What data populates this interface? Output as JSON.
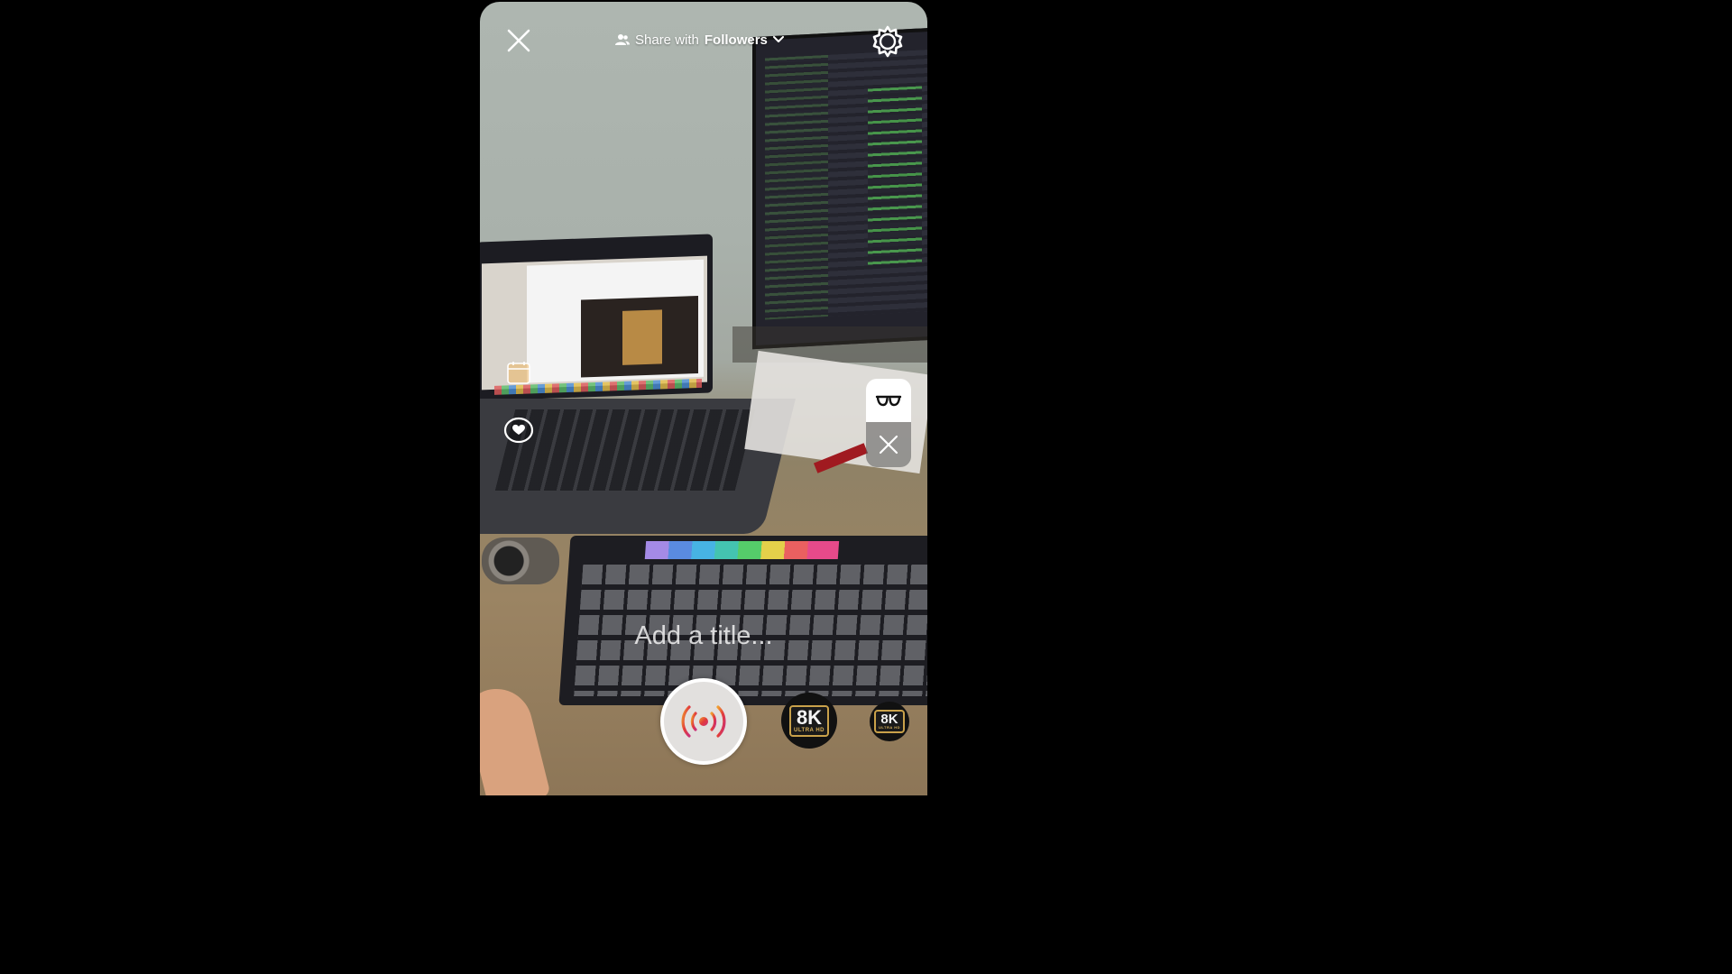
{
  "header": {
    "share_prefix": "Share with",
    "share_audience": "Followers",
    "close_icon": "close-icon",
    "settings_icon": "gear-icon",
    "audience_icon": "people-icon",
    "dropdown_icon": "chevron-down-icon"
  },
  "side_tools": {
    "effect_icon": "glasses-icon",
    "effect_close_icon": "close-icon",
    "heart_icon": "heart-icon",
    "sticker_icon": "calendar-icon"
  },
  "bottom": {
    "title_placeholder": "Add a title...",
    "go_live_icon": "live-broadcast-icon",
    "quality_large": {
      "main": "8K",
      "sub": "ULTRA HD"
    },
    "quality_small": {
      "main": "8K",
      "sub": "ULTRA HD"
    }
  },
  "colors": {
    "live_accent_start": "#e23b3b",
    "live_accent_end": "#f0a030",
    "badge_gold": "#c9a14a"
  }
}
